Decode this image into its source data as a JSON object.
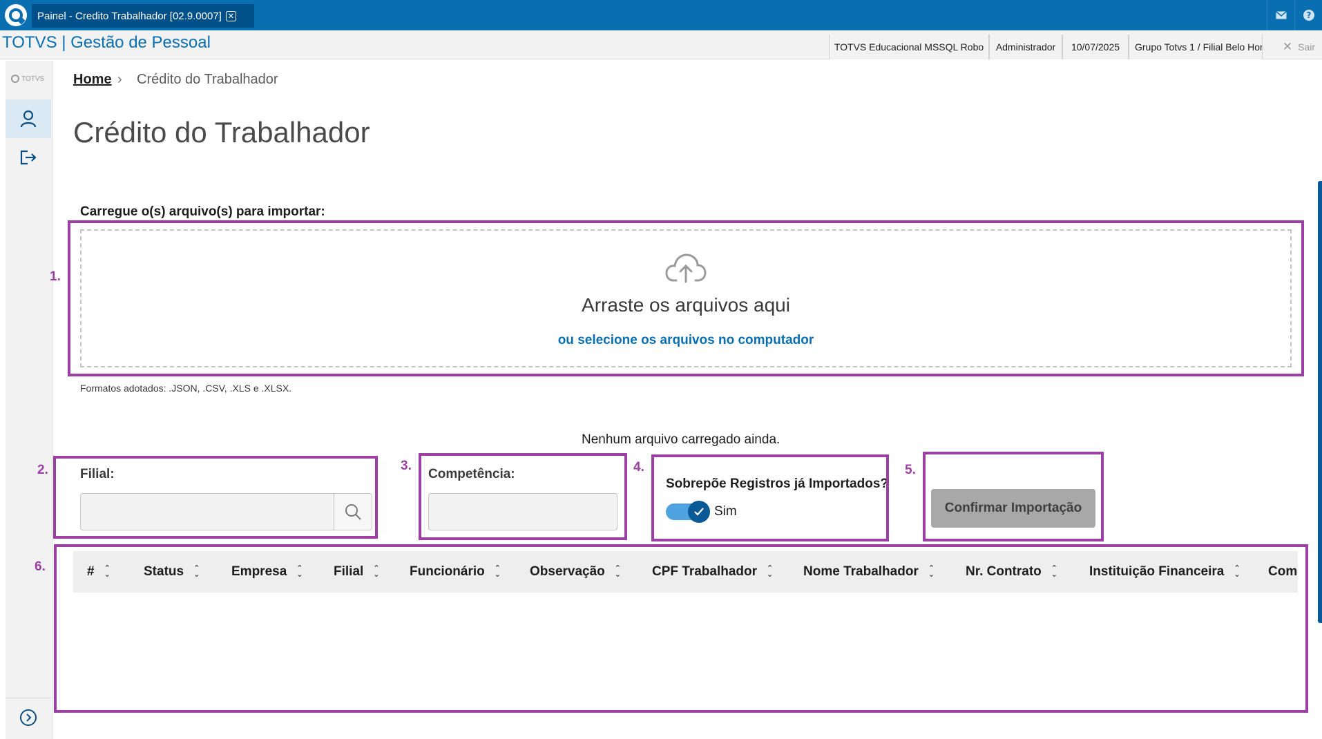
{
  "window": {
    "tab_title": "Painel - Credito Trabalhador [02.9.0007]",
    "tab_close_icon": "close-icon"
  },
  "header": {
    "app_title": "TOTVS | Gestão de Pessoal",
    "environment": "TOTVS Educacional MSSQL Robo",
    "user": "Administrador",
    "date": "10/07/2025",
    "branch": "Grupo Totvs 1 / Filial Belo Hor",
    "logout_label": "Sair"
  },
  "sidebar": {
    "logo_text": "TOTVS"
  },
  "breadcrumb": {
    "home": "Home",
    "current": "Crédito do Trabalhador"
  },
  "page": {
    "title": "Crédito do Trabalhador"
  },
  "upload": {
    "label": "Carregue o(s) arquivo(s) para importar:",
    "drop_title": "Arraste os arquivos aqui",
    "select_link": "ou selecione os arquivos no computador",
    "formats": "Formatos adotados: .JSON, .CSV, .XLS e .XLSX.",
    "status": "Nenhum arquivo carregado ainda."
  },
  "form": {
    "filial_label": "Filial:",
    "filial_value": "",
    "competencia_label": "Competência:",
    "competencia_value": "",
    "overwrite_label": "Sobrepõe Registros já Importados?",
    "overwrite_value": "Sim",
    "confirm_label": "Confirmar Importação"
  },
  "table": {
    "columns": [
      "#",
      "Status",
      "Empresa",
      "Filial",
      "Funcionário",
      "Observação",
      "CPF Trabalhador",
      "Nome Trabalhador",
      "Nr. Contrato",
      "Instituição Financeira",
      "Com"
    ]
  },
  "annotations": [
    "1.",
    "2.",
    "3.",
    "4.",
    "5.",
    "6."
  ],
  "colors": {
    "brand_blue": "#0a6fb0",
    "annotation_purple": "#9b3fa3",
    "disabled_button": "#a8a8a8"
  }
}
